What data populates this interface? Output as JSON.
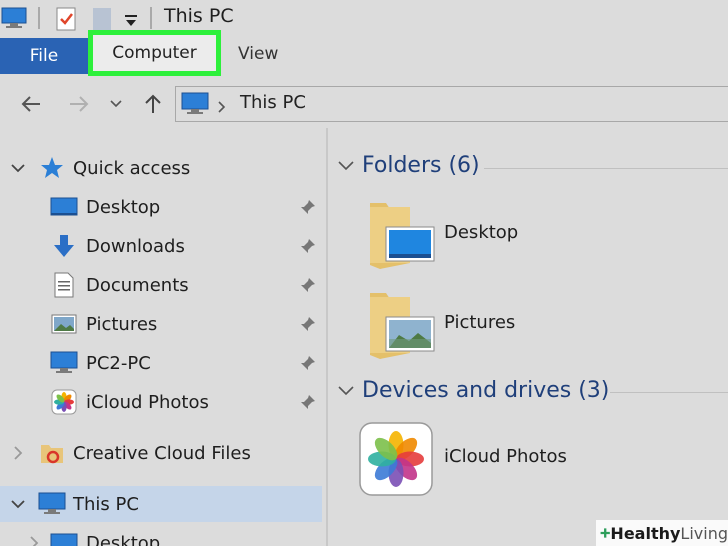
{
  "window": {
    "title": "This PC"
  },
  "ribbon": {
    "tabs": {
      "file": "File",
      "computer": "Computer",
      "view": "View"
    }
  },
  "address": {
    "path": "This PC"
  },
  "sidebar": {
    "quick_access": "Quick access",
    "items": [
      {
        "label": "Desktop",
        "icon": "desktop-icon"
      },
      {
        "label": "Downloads",
        "icon": "download-arrow-icon"
      },
      {
        "label": "Documents",
        "icon": "document-icon"
      },
      {
        "label": "Pictures",
        "icon": "pictures-icon"
      },
      {
        "label": "PC2-PC",
        "icon": "computer-icon"
      },
      {
        "label": "iCloud Photos",
        "icon": "icloud-photos-icon"
      }
    ],
    "creative_cloud": "Creative Cloud Files",
    "this_pc": "This PC",
    "this_pc_child": "Desktop"
  },
  "main": {
    "folders_header": "Folders (6)",
    "folders": [
      {
        "label": "Desktop"
      },
      {
        "label": "Pictures"
      }
    ],
    "devices_header": "Devices and drives (3)",
    "devices": [
      {
        "label": "iCloud Photos"
      }
    ]
  },
  "watermark": {
    "brand_a": "Healthy",
    "brand_b": "Living"
  },
  "colors": {
    "file_tab": "#2a63b4",
    "highlight_box": "#2df03b",
    "header_text": "#1f3f7a",
    "selected_row": "#c5d5e9"
  }
}
